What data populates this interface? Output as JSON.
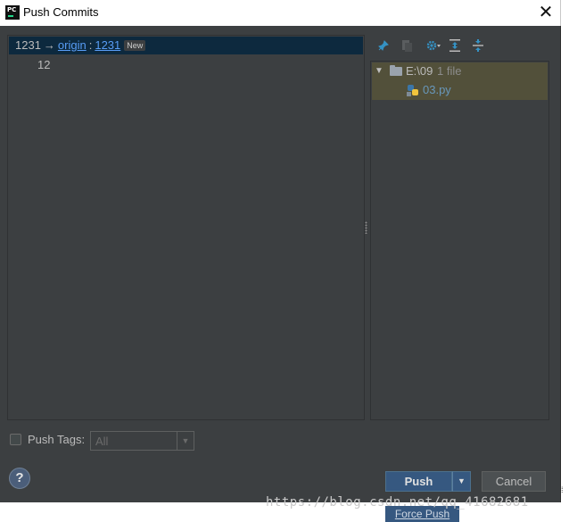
{
  "window": {
    "title": "Push Commits"
  },
  "commit_header": {
    "source_branch": "1231",
    "arrow": "→",
    "remote": "origin",
    "separator": ":",
    "target_branch": "1231",
    "badge": "New"
  },
  "commits": [
    {
      "message": "12"
    }
  ],
  "changes_tree": {
    "folder": {
      "path": "E:\\09",
      "count": "1 file"
    },
    "files": [
      {
        "name": "03.py"
      }
    ]
  },
  "toolbar_icons": [
    "pin-icon",
    "show-diff-icon",
    "settings-icon",
    "expand-all-icon",
    "collapse-all-icon"
  ],
  "options": {
    "push_tags_label": "Push Tags:",
    "push_tags_checked": false,
    "tags_value": "All"
  },
  "buttons": {
    "help": "?",
    "push": "Push",
    "cancel": "Cancel",
    "force_push": "Force Push"
  },
  "watermark": "https://blog.csdn.net/qq_41682681",
  "colors": {
    "accent": "#365880",
    "link": "#589df6",
    "selection": "#0d293e",
    "tree_selection": "#52503a"
  }
}
